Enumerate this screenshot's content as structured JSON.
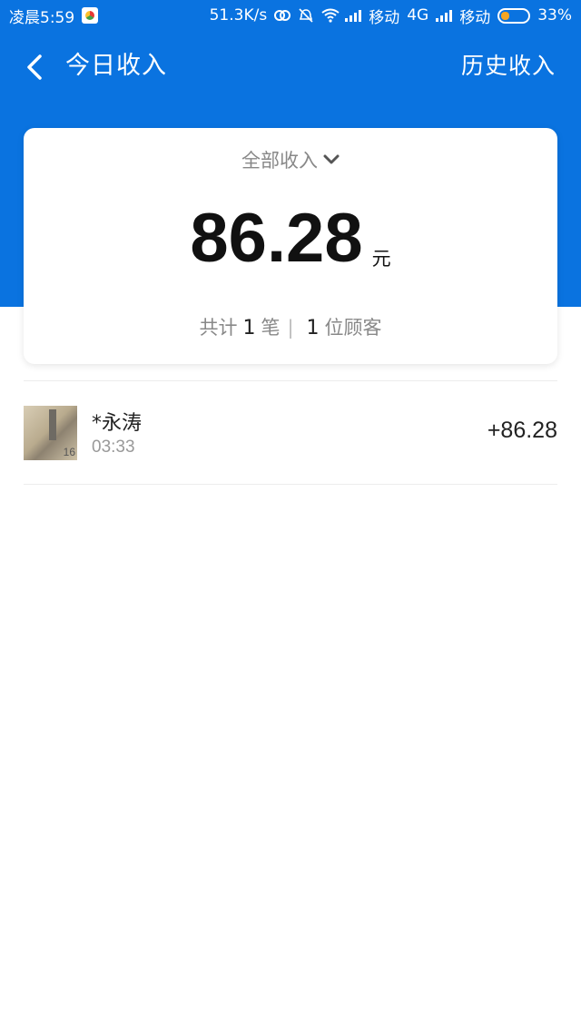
{
  "status_bar": {
    "time": "凌晨5:59",
    "speed": "51.3K/s",
    "carrier1": "移动",
    "network1": "4G",
    "carrier2": "移动",
    "battery": "33%",
    "icons": [
      "app-badge-icon",
      "sync-icon",
      "alarm-off-icon",
      "wifi-icon",
      "signal-icon",
      "battery-icon"
    ]
  },
  "nav": {
    "title": "今日收入",
    "right_link": "历史收入",
    "back_icon": "chevron-left-icon"
  },
  "summary": {
    "filter_label": "全部收入",
    "amount": "86.28",
    "unit": "元",
    "total_prefix": "共计",
    "count": "1",
    "count_unit": "笔",
    "separator": "|",
    "customers": "1",
    "customers_unit": "位顾客"
  },
  "transactions": [
    {
      "name": "*永涛",
      "time": "03:33",
      "amount": "+86.28",
      "avatar_tag": "16"
    }
  ],
  "colors": {
    "header_blue": "#0a73e0",
    "battery_orange": "#f5a623"
  }
}
